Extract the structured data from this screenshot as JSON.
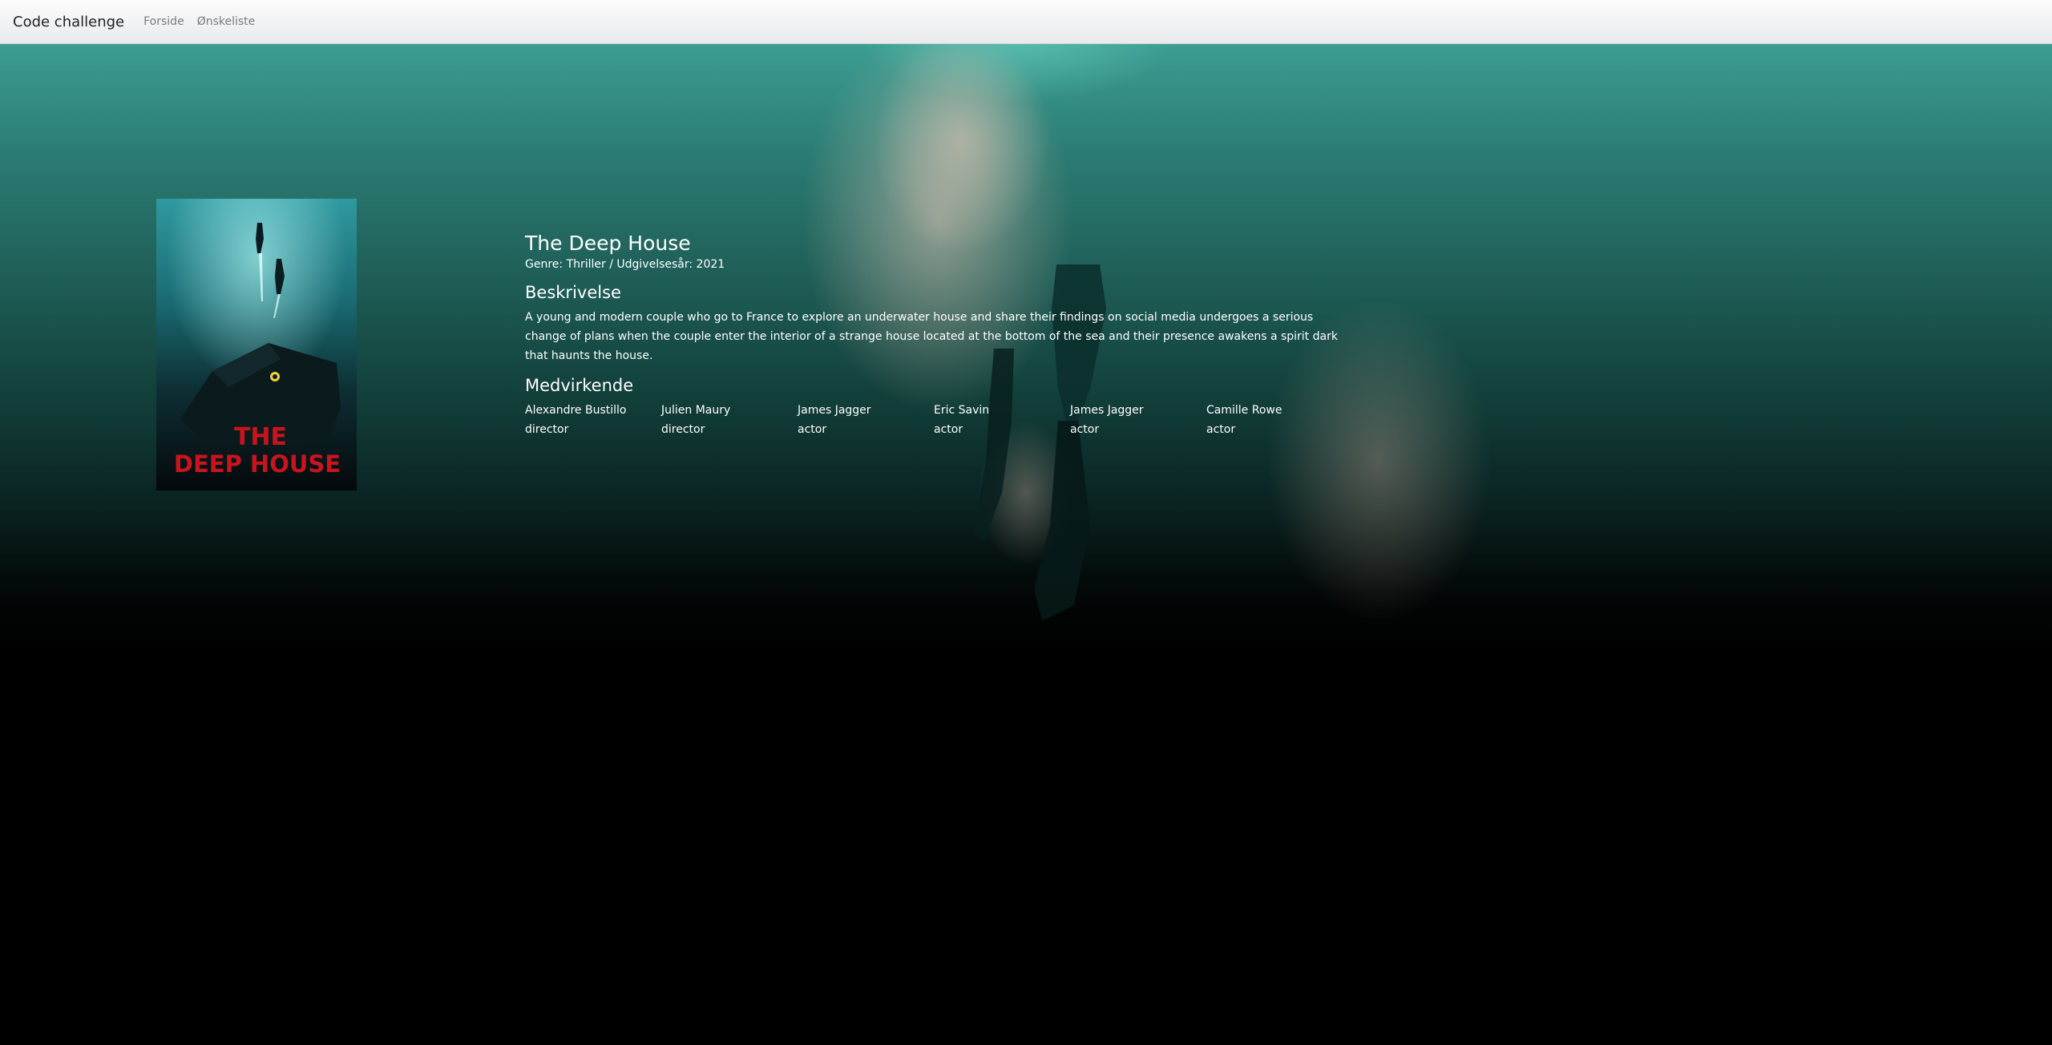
{
  "nav": {
    "brand": "Code challenge",
    "links": [
      "Forside",
      "Ønskeliste"
    ]
  },
  "poster": {
    "line1": "THE",
    "line2": "DEEP HOUSE"
  },
  "movie": {
    "title": "The Deep House",
    "meta": "Genre: Thriller / Udgivelsesår: 2021",
    "description_heading": "Beskrivelse",
    "description": "A young and modern couple who go to France to explore an underwater house and share their findings on social media undergoes a serious change of plans when the couple enter the interior of a strange house located at the bottom of the sea and their presence awakens a spirit dark that haunts the house.",
    "cast_heading": "Medvirkende",
    "cast": [
      {
        "name": "Alexandre Bustillo",
        "role": "director"
      },
      {
        "name": "Julien Maury",
        "role": "director"
      },
      {
        "name": "James Jagger",
        "role": "actor"
      },
      {
        "name": "Eric Savin",
        "role": "actor"
      },
      {
        "name": "James Jagger",
        "role": "actor"
      },
      {
        "name": "Camille Rowe",
        "role": "actor"
      }
    ]
  },
  "colors": {
    "sea_top": "#3d9d92",
    "sea_bottom": "#000000",
    "poster_title": "#c8141e"
  }
}
